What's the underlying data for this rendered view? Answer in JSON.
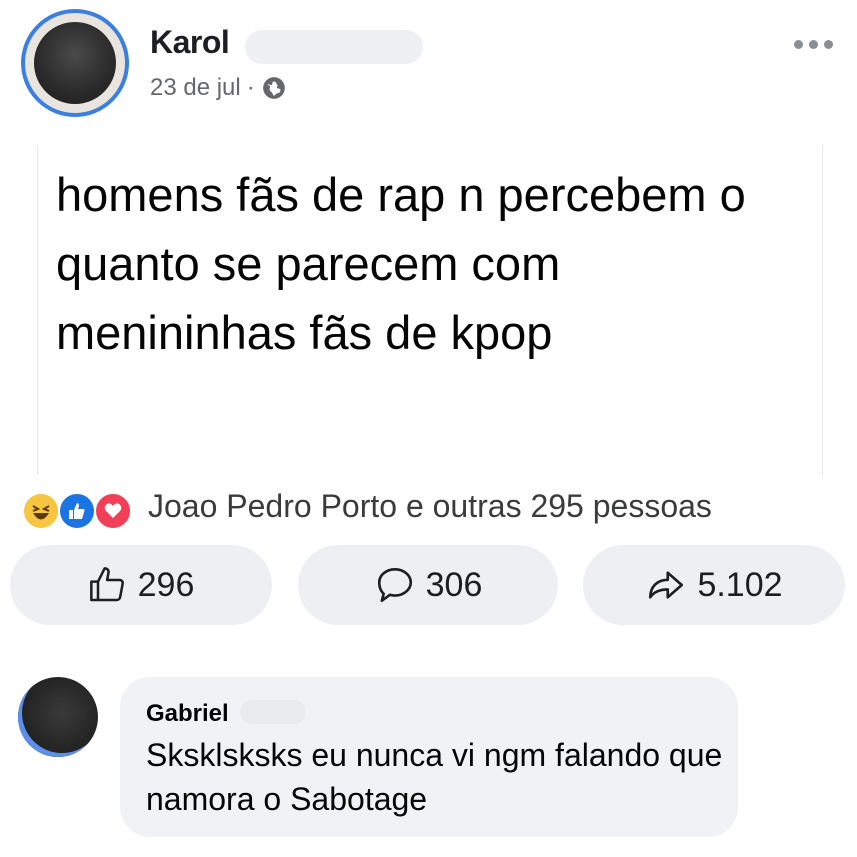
{
  "post": {
    "author": "Karol",
    "date": "23 de jul",
    "separator": "·",
    "text": "homens fãs de rap n percebem o quanto se parecem com menininhas fãs de kpop"
  },
  "reactions": {
    "icons": [
      "haha-icon",
      "like-icon",
      "love-icon"
    ],
    "summary": "Joao Pedro Porto e outras 295 pessoas"
  },
  "actions": {
    "likes": "296",
    "comments": "306",
    "shares": "5.102"
  },
  "comment": {
    "author": "Gabriel",
    "text": "Sksklsksks eu nunca vi ngm falando que namora o Sabotage"
  },
  "colors": {
    "accent": "#1b74e4",
    "love": "#f33e58",
    "haha": "#f7c640",
    "pill_bg": "#edeff2",
    "muted_text": "#65676b"
  }
}
